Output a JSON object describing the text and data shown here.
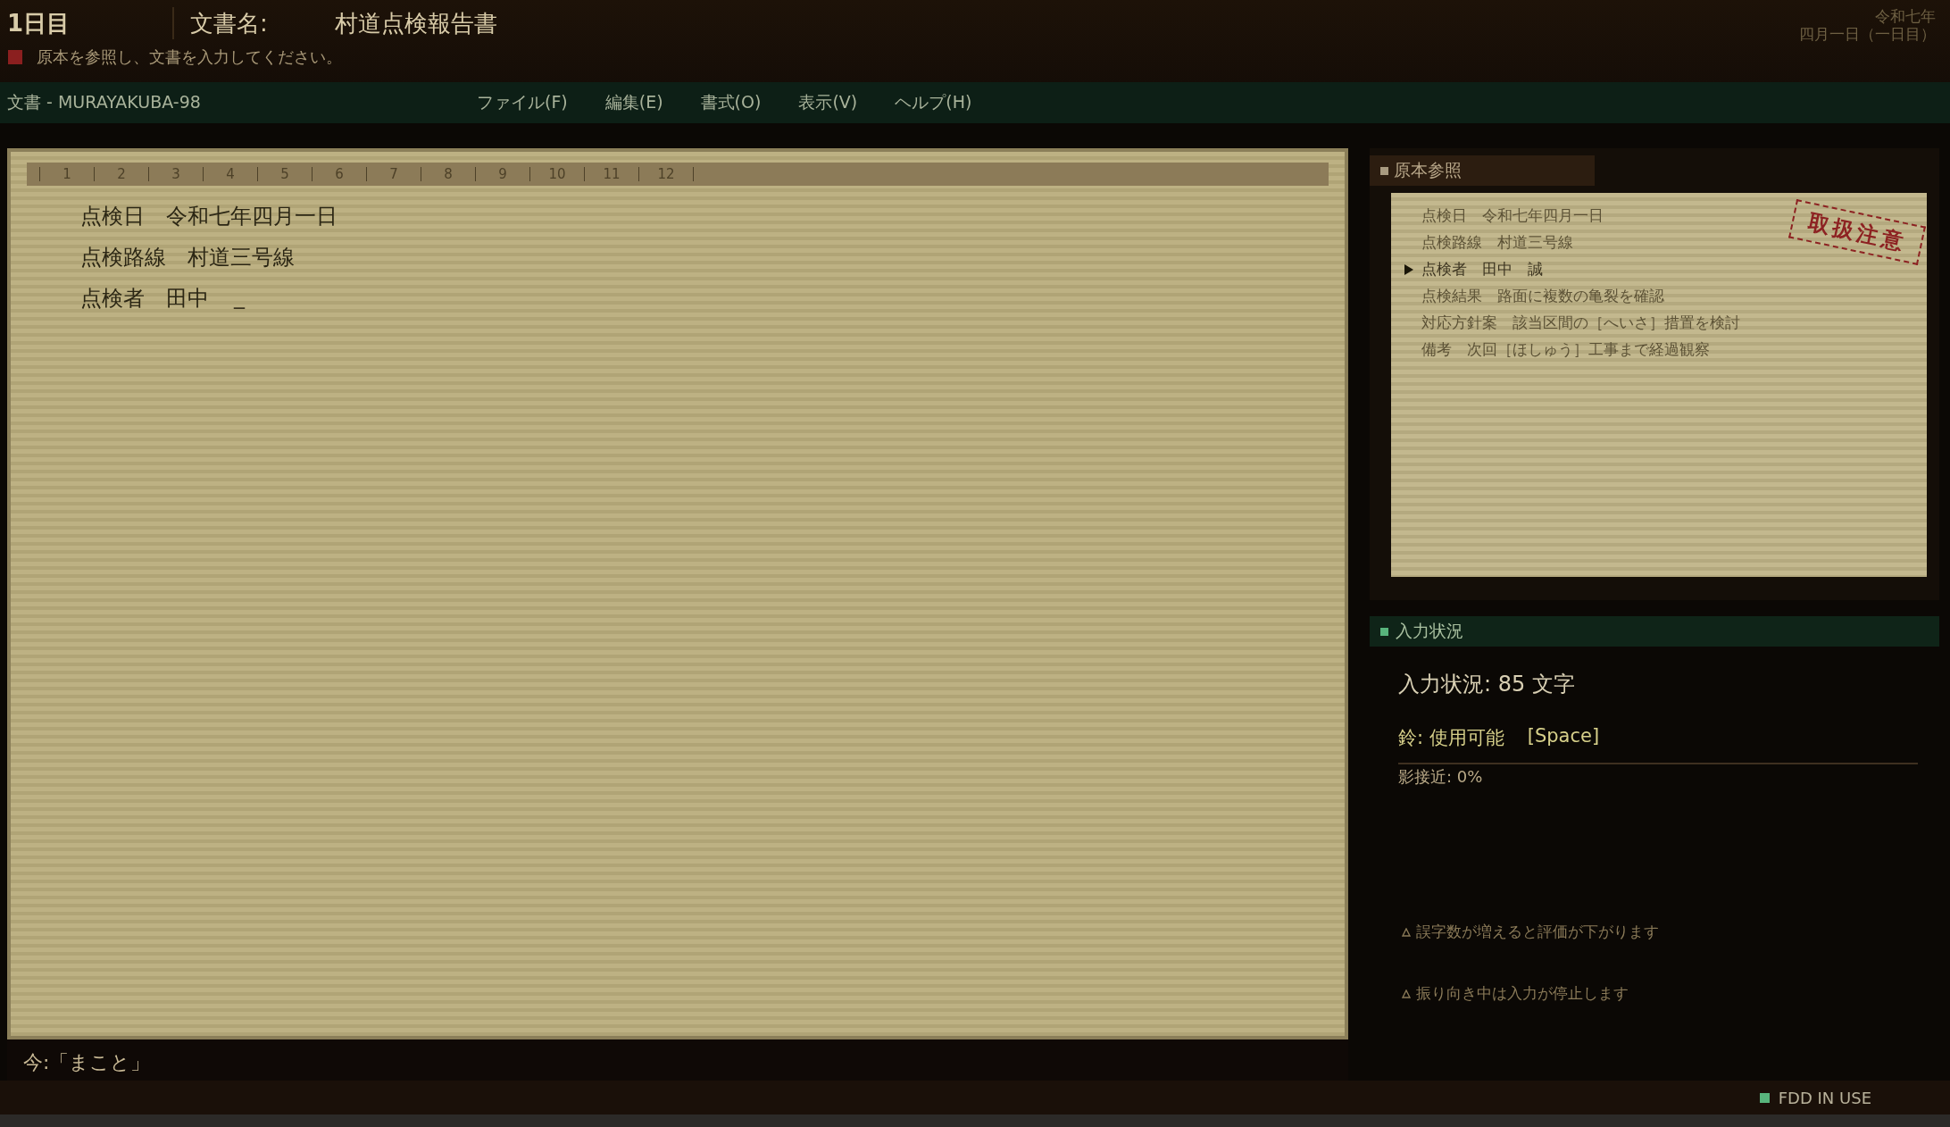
{
  "header": {
    "day": "1日目",
    "doc_label": "文書名:",
    "doc_name": "村道点検報告書",
    "instruction": "原本を参照し、文書を入力してください。",
    "date_lines": [
      "令和七年",
      "四月一日（一日目）"
    ]
  },
  "menubar": {
    "title": "文書 - MURAYAKUBA-98",
    "menus": [
      "ファイル(F)",
      "編集(E)",
      "書式(O)",
      "表示(V)",
      "ヘルプ(H)"
    ]
  },
  "editor": {
    "ruler": [
      "1",
      "2",
      "3",
      "4",
      "5",
      "6",
      "7",
      "8",
      "9",
      "10",
      "11",
      "12"
    ],
    "lines": [
      "点検日　令和七年四月一日",
      "点検路線　村道三号線",
      "点検者　田中"
    ],
    "cursor": "_"
  },
  "speech": "今:「まこと」",
  "reference": {
    "title": "原本参照",
    "stamp": "取扱注意",
    "items": [
      {
        "text": "点検日　令和七年四月一日",
        "selected": false
      },
      {
        "text": "点検路線　村道三号線",
        "selected": false
      },
      {
        "text": "点検者　田中　誠",
        "selected": true
      },
      {
        "text": "点検結果　路面に複数の亀裂を確認",
        "selected": false
      },
      {
        "text": "対応方針案　該当区間の［へいさ］措置を検討",
        "selected": false
      },
      {
        "text": "備考　次回［ほしゅう］工事まで経過観察",
        "selected": false
      }
    ]
  },
  "status": {
    "title": "入力状況",
    "count": "入力状況: 85 文字",
    "bell": "鈴: 使用可能",
    "bell_key": "[Space]",
    "shadow": {
      "label": "影接近: 0%"
    },
    "notes": [
      "誤字数が増えると評価が下がります",
      "振り向き中は入力が停止します"
    ]
  },
  "status_bar": {
    "indicator": "FDD IN USE"
  }
}
